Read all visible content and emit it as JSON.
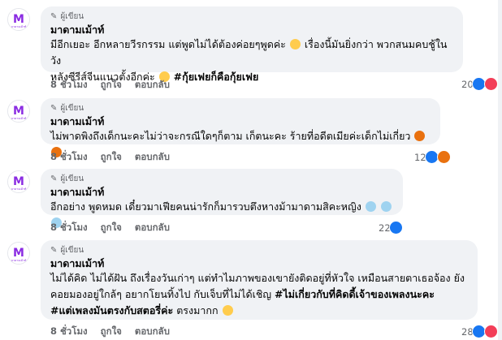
{
  "comments": [
    {
      "role": "ผู้เขียน",
      "name": "มาดามเม้าท์",
      "lines": [
        "มีอีกเยอะ อีกหลายวีรกรรม แต่พูดไม่ได้ต้องค่อยๆพูดค่ะ",
        "เรื่องนี้มันยิ่งกว่า พวกสนมคบชู้ในวัง",
        "หลังซีรีส์จีนแนวตั้งอีกค่ะ"
      ],
      "hashtag": "#กุ้ยเฟยก็คือกุ้ยเฟย",
      "time": "8 ชั่วโมง",
      "like": "ถูกใจ",
      "reply": "ตอบกลับ",
      "reaction_count": "20"
    },
    {
      "role": "ผู้เขียน",
      "name": "มาดามเม้าท์",
      "lines": [
        "ไม่พาดพิงถึงเด็กนะคะไม่ว่าจะกรณีใดๆก็ตาม เก็ตนะคะ ร้ายที่อดีตเมียค่ะเด็กไม่เกี่ยว"
      ],
      "time": "8 ชั่วโมง",
      "like": "ถูกใจ",
      "reply": "ตอบกลับ",
      "reaction_count": "12"
    },
    {
      "role": "ผู้เขียน",
      "name": "มาดามเม้าท์",
      "lines": [
        "อีกอย่าง พูดหมด เดี๋ยวมาเฟียคนน่ารักก็มารวบตึงหางม้ามาดามสิคะหญิง"
      ],
      "time": "8 ชั่วโมง",
      "like": "ถูกใจ",
      "reply": "ตอบกลับ",
      "reaction_count": "22"
    },
    {
      "role": "ผู้เขียน",
      "name": "มาดามเม้าท์",
      "lines": [
        "ไม่ได้คิด ไม่ได้ฝัน ถึงเรื่องวันเก่าๆ แต่ทำไมภาพของเขายังติดอยู่ที่หัวใจ เหมือนสายตาเธอจ้อง ยัง",
        "คอยมองอยู่ใกล้ๆ อยากโยนทิ้งไป กับเจ็บที่ไม่ได้เชิญ"
      ],
      "hashtag": "#ไม่เกี่ยวกับที่คิดดี้เจ้าของเพลงนะคะ",
      "hashtag2": "#แต่เพลงมันตรงกับสตอรี่ค่ะ",
      "tail": "ตรงมากก",
      "time": "8 ชั่วโมง",
      "like": "ถูกใจ",
      "reply": "ตอบกลับ",
      "reaction_count": "28"
    }
  ],
  "colors": {
    "like": "#1877f2",
    "love": "#f33e58",
    "angry": "#e9710f",
    "brand": "#8a2be2"
  }
}
